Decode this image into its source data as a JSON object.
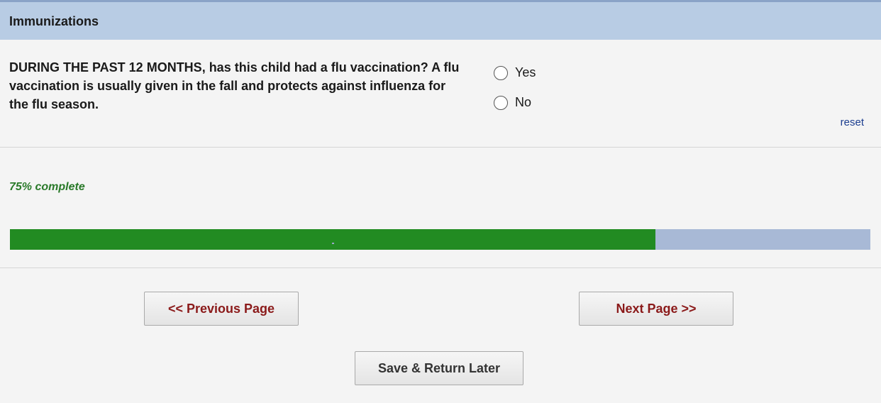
{
  "section": {
    "title": "Immunizations"
  },
  "question": {
    "text": "DURING THE PAST 12 MONTHS, has this child had a flu vaccination? A flu vaccination is usually given in the fall and protects against influenza for the flu season.",
    "options": [
      {
        "label": "Yes",
        "selected": false
      },
      {
        "label": "No",
        "selected": false
      }
    ],
    "reset_label": "reset"
  },
  "progress": {
    "label": "75% complete",
    "percent": 75,
    "fill_color": "#228b22",
    "track_color": "#a8b9d6"
  },
  "buttons": {
    "previous": "<< Previous Page",
    "next": "Next Page >>",
    "save": "Save & Return Later"
  },
  "colors": {
    "header_bg": "#b8cce4",
    "nav_button_text": "#8b1a1a",
    "link": "#1b3d8f"
  }
}
